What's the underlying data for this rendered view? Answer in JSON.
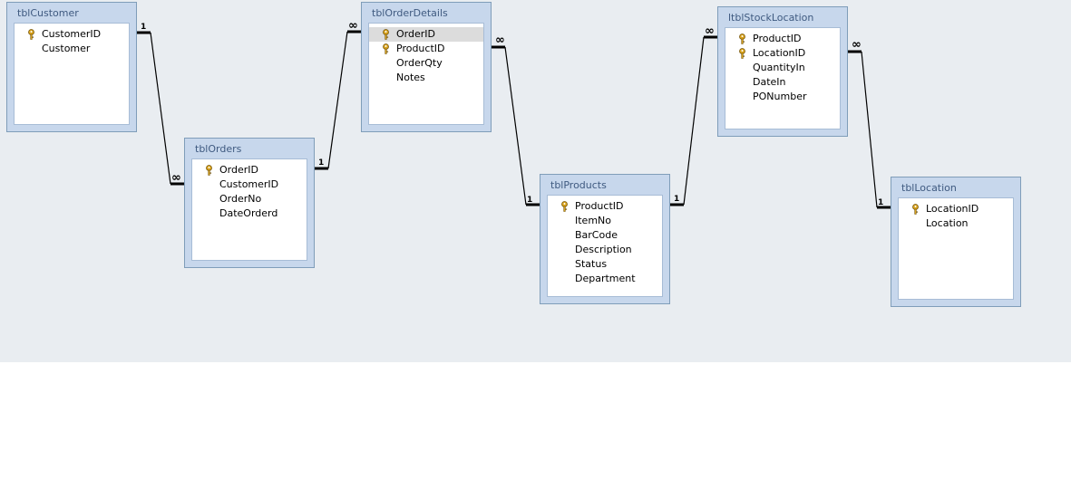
{
  "tables": [
    {
      "id": "customer",
      "title": "tblCustomer",
      "fields": [
        {
          "name": "CustomerID",
          "key": true
        },
        {
          "name": "Customer",
          "key": false
        }
      ]
    },
    {
      "id": "orders",
      "title": "tblOrders",
      "fields": [
        {
          "name": "OrderID",
          "key": true
        },
        {
          "name": "CustomerID",
          "key": false
        },
        {
          "name": "OrderNo",
          "key": false
        },
        {
          "name": "DateOrderd",
          "key": false
        }
      ]
    },
    {
      "id": "orderdetails",
      "title": "tblOrderDetails",
      "fields": [
        {
          "name": "OrderID",
          "key": true,
          "selected": true
        },
        {
          "name": "ProductID",
          "key": true
        },
        {
          "name": "OrderQty",
          "key": false
        },
        {
          "name": "Notes",
          "key": false
        }
      ]
    },
    {
      "id": "products",
      "title": "tblProducts",
      "fields": [
        {
          "name": "ProductID",
          "key": true
        },
        {
          "name": "ItemNo",
          "key": false
        },
        {
          "name": "BarCode",
          "key": false
        },
        {
          "name": "Description",
          "key": false
        },
        {
          "name": "Status",
          "key": false
        },
        {
          "name": "Department",
          "key": false
        }
      ]
    },
    {
      "id": "stocklocation",
      "title": "ltblStockLocation",
      "fields": [
        {
          "name": "ProductID",
          "key": true
        },
        {
          "name": "LocationID",
          "key": true
        },
        {
          "name": "QuantityIn",
          "key": false
        },
        {
          "name": "DateIn",
          "key": false
        },
        {
          "name": "PONumber",
          "key": false
        }
      ]
    },
    {
      "id": "location",
      "title": "tblLocation",
      "fields": [
        {
          "name": "LocationID",
          "key": true
        },
        {
          "name": "Location",
          "key": false
        }
      ]
    }
  ],
  "relationships": [
    {
      "from": "customer",
      "from_mult": "1",
      "to": "orders",
      "to_mult": "∞"
    },
    {
      "from": "orders",
      "from_mult": "1",
      "to": "orderdetails",
      "to_mult": "∞"
    },
    {
      "from": "orderdetails",
      "from_mult": "∞",
      "to": "products",
      "to_mult": "1"
    },
    {
      "from": "products",
      "from_mult": "1",
      "to": "stocklocation",
      "to_mult": "∞"
    },
    {
      "from": "stocklocation",
      "from_mult": "∞",
      "to": "location",
      "to_mult": "1"
    }
  ],
  "colors": {
    "canvas": "#e9edf1",
    "table_frame": "#c7d7ec",
    "title_text": "#3f5a80",
    "key_icon": "#d9a21b"
  },
  "icons": {
    "primary_key": "key-icon"
  }
}
